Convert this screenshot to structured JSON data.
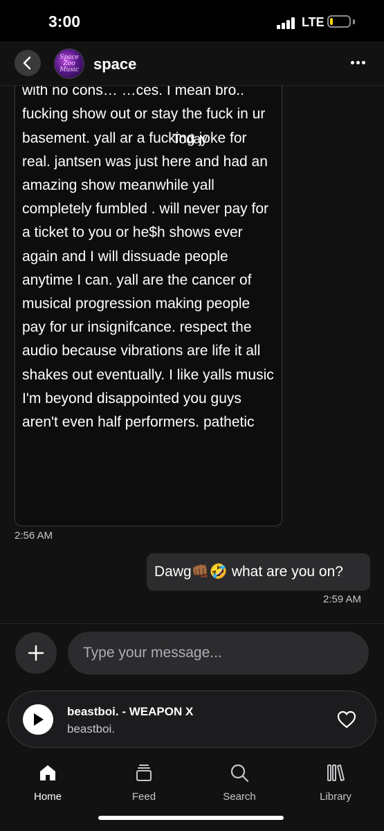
{
  "status_bar": {
    "time": "3:00",
    "network": "LTE",
    "battery_level": 0.15,
    "battery_color": "#ffd60a"
  },
  "header": {
    "title": "space",
    "avatar_text": "Space Zoo Music"
  },
  "conversation": {
    "date_separator": "Today",
    "messages": [
      {
        "direction": "incoming",
        "text": "a nice day job to let y… nudge around with no cons… …ces. I mean bro.. fucking show out or stay the fuck in ur basement. yall ar a fucking joke for real. jantsen was just here and had an amazing show meanwhile yall completely fumbled . will never pay for a ticket to you or he$h shows ever again and I will dissuade people anytime I can. yall are the cancer of musical progression making people pay for ur insignifcance. respect the audio because vibrations are life it all shakes out eventually. I like yalls music I'm beyond disappointed you guys aren't even half performers. pathetic",
        "time": "2:56 AM"
      },
      {
        "direction": "outgoing",
        "text": "Dawg👊🏾🤣 what are you on?",
        "time": "2:59 AM"
      }
    ]
  },
  "composer": {
    "placeholder": "Type your message..."
  },
  "now_playing": {
    "title": "beastboi. - WEAPON X",
    "artist": "beastboi."
  },
  "tabs": [
    {
      "label": "Home",
      "icon": "home-icon",
      "active": true
    },
    {
      "label": "Feed",
      "icon": "feed-icon",
      "active": false
    },
    {
      "label": "Search",
      "icon": "search-icon",
      "active": false
    },
    {
      "label": "Library",
      "icon": "library-icon",
      "active": false
    }
  ]
}
